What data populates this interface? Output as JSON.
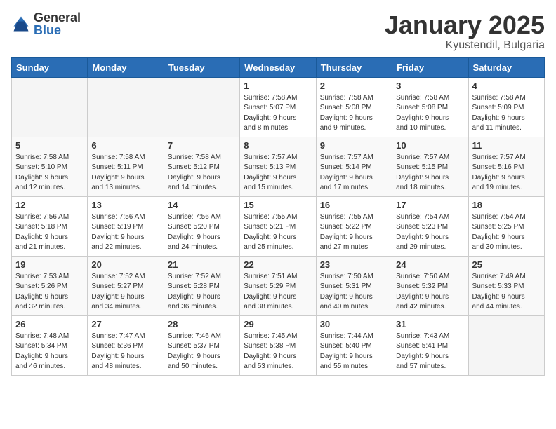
{
  "logo": {
    "general": "General",
    "blue": "Blue"
  },
  "title": "January 2025",
  "location": "Kyustendil, Bulgaria",
  "days_header": [
    "Sunday",
    "Monday",
    "Tuesday",
    "Wednesday",
    "Thursday",
    "Friday",
    "Saturday"
  ],
  "weeks": [
    [
      {
        "day": "",
        "info": ""
      },
      {
        "day": "",
        "info": ""
      },
      {
        "day": "",
        "info": ""
      },
      {
        "day": "1",
        "info": "Sunrise: 7:58 AM\nSunset: 5:07 PM\nDaylight: 9 hours\nand 8 minutes."
      },
      {
        "day": "2",
        "info": "Sunrise: 7:58 AM\nSunset: 5:08 PM\nDaylight: 9 hours\nand 9 minutes."
      },
      {
        "day": "3",
        "info": "Sunrise: 7:58 AM\nSunset: 5:08 PM\nDaylight: 9 hours\nand 10 minutes."
      },
      {
        "day": "4",
        "info": "Sunrise: 7:58 AM\nSunset: 5:09 PM\nDaylight: 9 hours\nand 11 minutes."
      }
    ],
    [
      {
        "day": "5",
        "info": "Sunrise: 7:58 AM\nSunset: 5:10 PM\nDaylight: 9 hours\nand 12 minutes."
      },
      {
        "day": "6",
        "info": "Sunrise: 7:58 AM\nSunset: 5:11 PM\nDaylight: 9 hours\nand 13 minutes."
      },
      {
        "day": "7",
        "info": "Sunrise: 7:58 AM\nSunset: 5:12 PM\nDaylight: 9 hours\nand 14 minutes."
      },
      {
        "day": "8",
        "info": "Sunrise: 7:57 AM\nSunset: 5:13 PM\nDaylight: 9 hours\nand 15 minutes."
      },
      {
        "day": "9",
        "info": "Sunrise: 7:57 AM\nSunset: 5:14 PM\nDaylight: 9 hours\nand 17 minutes."
      },
      {
        "day": "10",
        "info": "Sunrise: 7:57 AM\nSunset: 5:15 PM\nDaylight: 9 hours\nand 18 minutes."
      },
      {
        "day": "11",
        "info": "Sunrise: 7:57 AM\nSunset: 5:16 PM\nDaylight: 9 hours\nand 19 minutes."
      }
    ],
    [
      {
        "day": "12",
        "info": "Sunrise: 7:56 AM\nSunset: 5:18 PM\nDaylight: 9 hours\nand 21 minutes."
      },
      {
        "day": "13",
        "info": "Sunrise: 7:56 AM\nSunset: 5:19 PM\nDaylight: 9 hours\nand 22 minutes."
      },
      {
        "day": "14",
        "info": "Sunrise: 7:56 AM\nSunset: 5:20 PM\nDaylight: 9 hours\nand 24 minutes."
      },
      {
        "day": "15",
        "info": "Sunrise: 7:55 AM\nSunset: 5:21 PM\nDaylight: 9 hours\nand 25 minutes."
      },
      {
        "day": "16",
        "info": "Sunrise: 7:55 AM\nSunset: 5:22 PM\nDaylight: 9 hours\nand 27 minutes."
      },
      {
        "day": "17",
        "info": "Sunrise: 7:54 AM\nSunset: 5:23 PM\nDaylight: 9 hours\nand 29 minutes."
      },
      {
        "day": "18",
        "info": "Sunrise: 7:54 AM\nSunset: 5:25 PM\nDaylight: 9 hours\nand 30 minutes."
      }
    ],
    [
      {
        "day": "19",
        "info": "Sunrise: 7:53 AM\nSunset: 5:26 PM\nDaylight: 9 hours\nand 32 minutes."
      },
      {
        "day": "20",
        "info": "Sunrise: 7:52 AM\nSunset: 5:27 PM\nDaylight: 9 hours\nand 34 minutes."
      },
      {
        "day": "21",
        "info": "Sunrise: 7:52 AM\nSunset: 5:28 PM\nDaylight: 9 hours\nand 36 minutes."
      },
      {
        "day": "22",
        "info": "Sunrise: 7:51 AM\nSunset: 5:29 PM\nDaylight: 9 hours\nand 38 minutes."
      },
      {
        "day": "23",
        "info": "Sunrise: 7:50 AM\nSunset: 5:31 PM\nDaylight: 9 hours\nand 40 minutes."
      },
      {
        "day": "24",
        "info": "Sunrise: 7:50 AM\nSunset: 5:32 PM\nDaylight: 9 hours\nand 42 minutes."
      },
      {
        "day": "25",
        "info": "Sunrise: 7:49 AM\nSunset: 5:33 PM\nDaylight: 9 hours\nand 44 minutes."
      }
    ],
    [
      {
        "day": "26",
        "info": "Sunrise: 7:48 AM\nSunset: 5:34 PM\nDaylight: 9 hours\nand 46 minutes."
      },
      {
        "day": "27",
        "info": "Sunrise: 7:47 AM\nSunset: 5:36 PM\nDaylight: 9 hours\nand 48 minutes."
      },
      {
        "day": "28",
        "info": "Sunrise: 7:46 AM\nSunset: 5:37 PM\nDaylight: 9 hours\nand 50 minutes."
      },
      {
        "day": "29",
        "info": "Sunrise: 7:45 AM\nSunset: 5:38 PM\nDaylight: 9 hours\nand 53 minutes."
      },
      {
        "day": "30",
        "info": "Sunrise: 7:44 AM\nSunset: 5:40 PM\nDaylight: 9 hours\nand 55 minutes."
      },
      {
        "day": "31",
        "info": "Sunrise: 7:43 AM\nSunset: 5:41 PM\nDaylight: 9 hours\nand 57 minutes."
      },
      {
        "day": "",
        "info": ""
      }
    ]
  ]
}
